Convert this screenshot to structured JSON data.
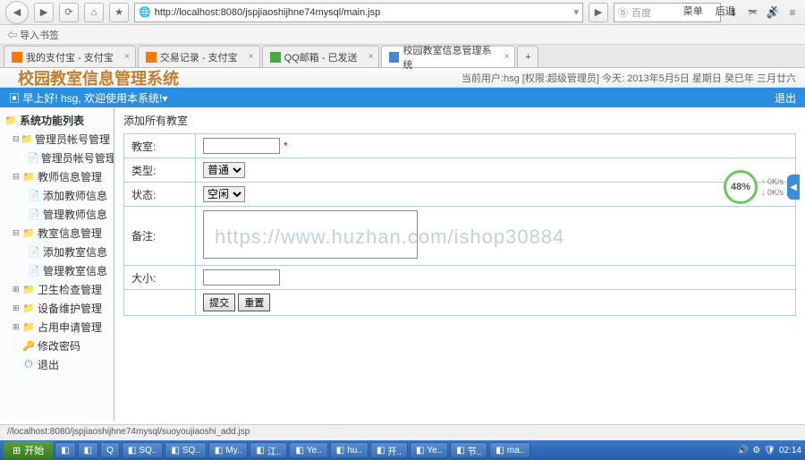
{
  "browser": {
    "menu": {
      "menu": "菜单",
      "back": "后退",
      "min": "一",
      "close": "✕"
    },
    "url": "http://localhost:8080/jspjiaoshijhne74mysql/main.jsp",
    "search_placeholder": "百度",
    "bookmark_import": "导入书签",
    "tabs": [
      {
        "label": "我的支付宝 - 支付宝",
        "fav": "#ff7700"
      },
      {
        "label": "交易记录 - 支付宝",
        "fav": "#ff7700"
      },
      {
        "label": "QQ邮箱 - 已发送",
        "fav": "#44aa44"
      },
      {
        "label": "校园教室信息管理系统",
        "fav": "#4488dd",
        "active": true
      }
    ]
  },
  "app": {
    "title": "校园教室信息管理系统",
    "user_label": "当前用户:",
    "user": "hsg",
    "role": "[权限:超级管理员]",
    "today_label": "今天:",
    "date": "2013年5月5日 星期日 癸巳年 三月廿六",
    "welcome_prefix": "早上好! hsg, 欢迎使用本系统!",
    "logout": "退出"
  },
  "sidebar": {
    "root": "系统功能列表",
    "nodes": [
      {
        "label": "管理员帐号管理",
        "children": [
          {
            "label": "管理员帐号管理"
          }
        ]
      },
      {
        "label": "教师信息管理",
        "children": [
          {
            "label": "添加教师信息"
          },
          {
            "label": "管理教师信息"
          }
        ]
      },
      {
        "label": "教室信息管理",
        "children": [
          {
            "label": "添加教室信息"
          },
          {
            "label": "管理教室信息"
          }
        ]
      },
      {
        "label": "卫生检查管理"
      },
      {
        "label": "设备维护管理"
      },
      {
        "label": "占用申请管理"
      },
      {
        "label": "修改密码",
        "leaf": true
      },
      {
        "label": "退出",
        "leaf": true
      }
    ]
  },
  "form": {
    "heading": "添加所有教室",
    "fields": {
      "classroom": {
        "label": "教室:",
        "value": "",
        "required": "*"
      },
      "type": {
        "label": "类型:",
        "value": "普通"
      },
      "status": {
        "label": "状态:",
        "value": "空闲"
      },
      "remark": {
        "label": "备注:",
        "value": ""
      },
      "size": {
        "label": "大小:",
        "value": ""
      }
    },
    "submit": "提交",
    "reset": "重置"
  },
  "status_bar": "//localhost:8080/jspjiaoshijhne74mysql/suoyoujiaoshi_add.jsp",
  "speed": {
    "pct": "48%",
    "up": "0K/s",
    "down": "0K/s"
  },
  "taskbar": {
    "start": "开始",
    "items": [
      "",
      "",
      "Q",
      "SQ..",
      "SQ..",
      "My..",
      "江..",
      "Ye..",
      "hu..",
      "开..",
      "Ye..",
      "节..",
      "ma.."
    ],
    "time": "02:14"
  },
  "watermark": "https://www.huzhan.com/ishop30884"
}
